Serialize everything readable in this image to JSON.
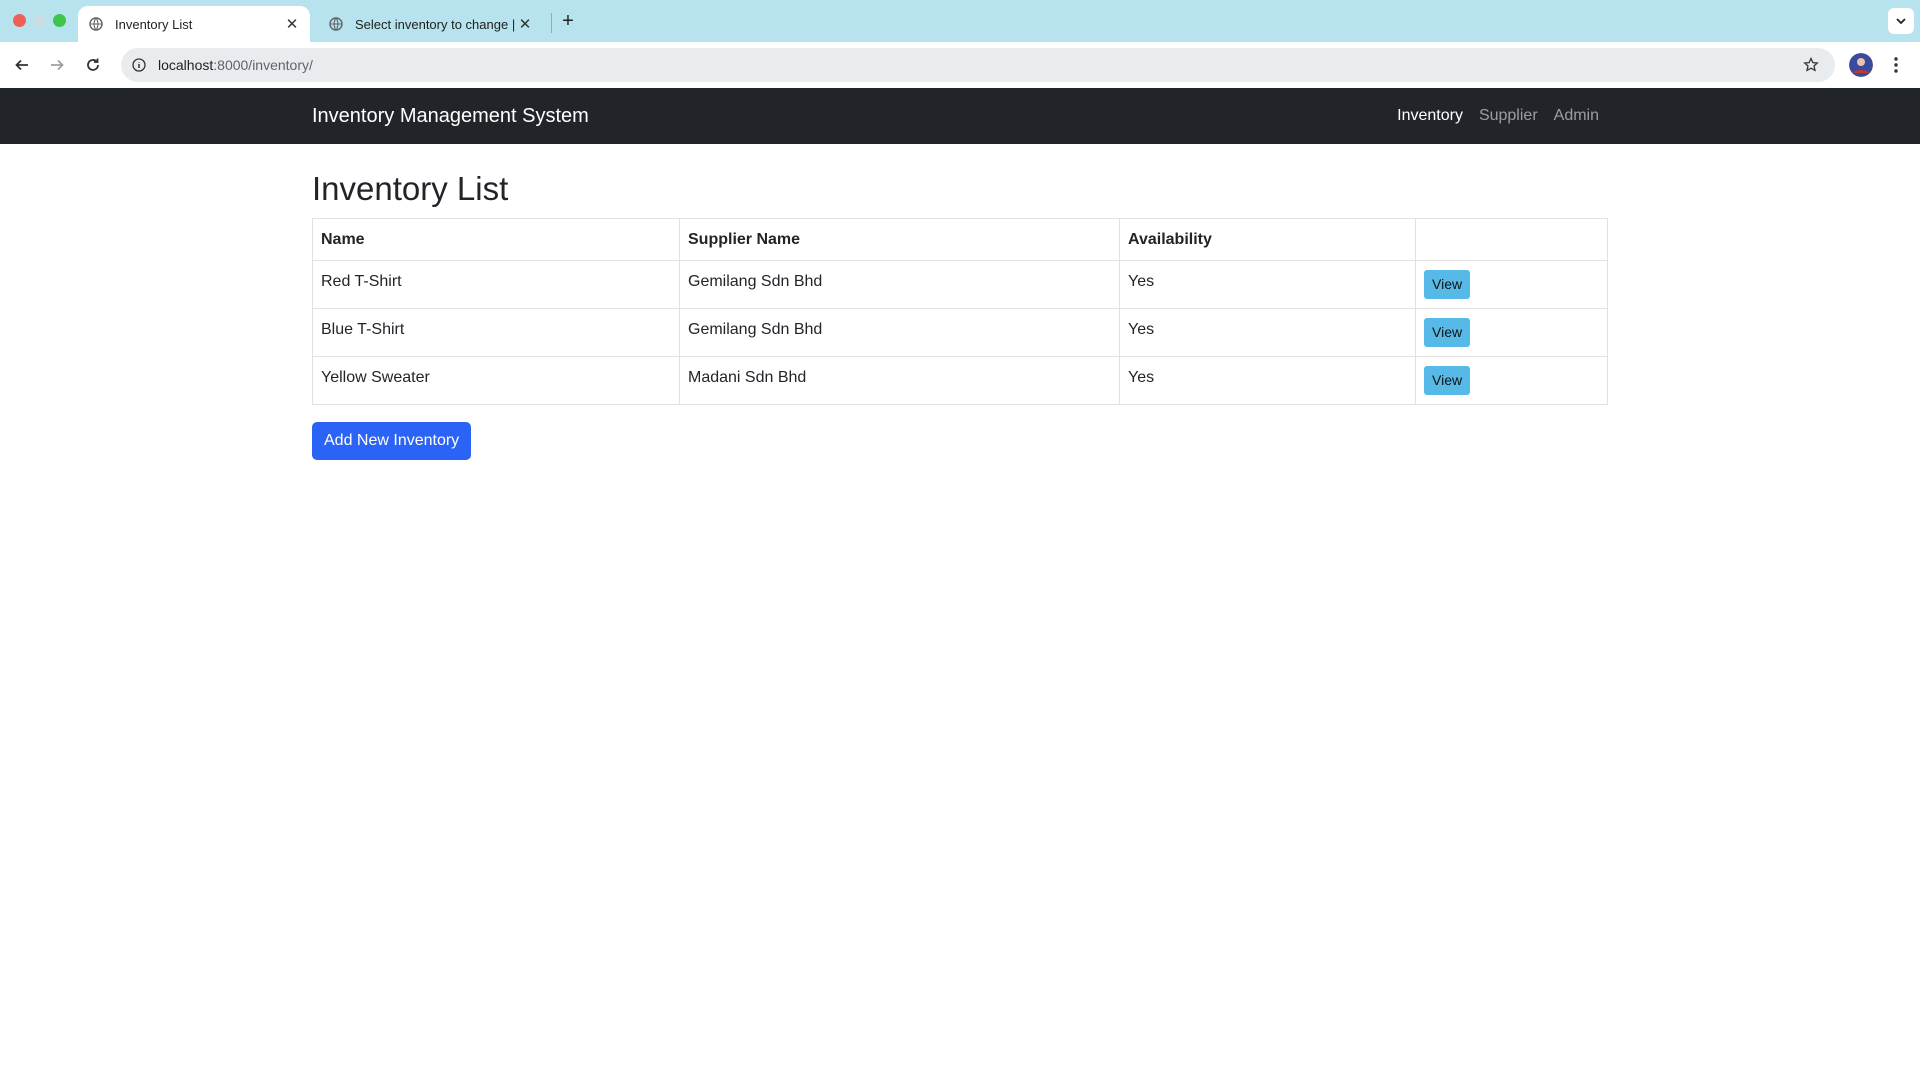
{
  "browser": {
    "tabs": [
      {
        "title": "Inventory List",
        "active": true
      },
      {
        "title": "Select inventory to change | D",
        "active": false
      }
    ],
    "url_host": "localhost",
    "url_path": ":8000/inventory/"
  },
  "navbar": {
    "brand": "Inventory Management System",
    "links": [
      {
        "label": "Inventory",
        "active": true
      },
      {
        "label": "Supplier",
        "active": false
      },
      {
        "label": "Admin",
        "active": false
      }
    ]
  },
  "main": {
    "heading": "Inventory List",
    "table": {
      "headers": [
        "Name",
        "Supplier Name",
        "Availability",
        ""
      ],
      "rows": [
        {
          "name": "Red T-Shirt",
          "supplier": "Gemilang Sdn Bhd",
          "availability": "Yes",
          "action": "View"
        },
        {
          "name": "Blue T-Shirt",
          "supplier": "Gemilang Sdn Bhd",
          "availability": "Yes",
          "action": "View"
        },
        {
          "name": "Yellow Sweater",
          "supplier": "Madani Sdn Bhd",
          "availability": "Yes",
          "action": "View"
        }
      ]
    },
    "add_button": "Add New Inventory"
  },
  "colors": {
    "navbar_bg": "#212529",
    "view_button": "#56b9e8",
    "add_button": "#2b63f6",
    "tabbar_bg": "#b7e3ee"
  }
}
